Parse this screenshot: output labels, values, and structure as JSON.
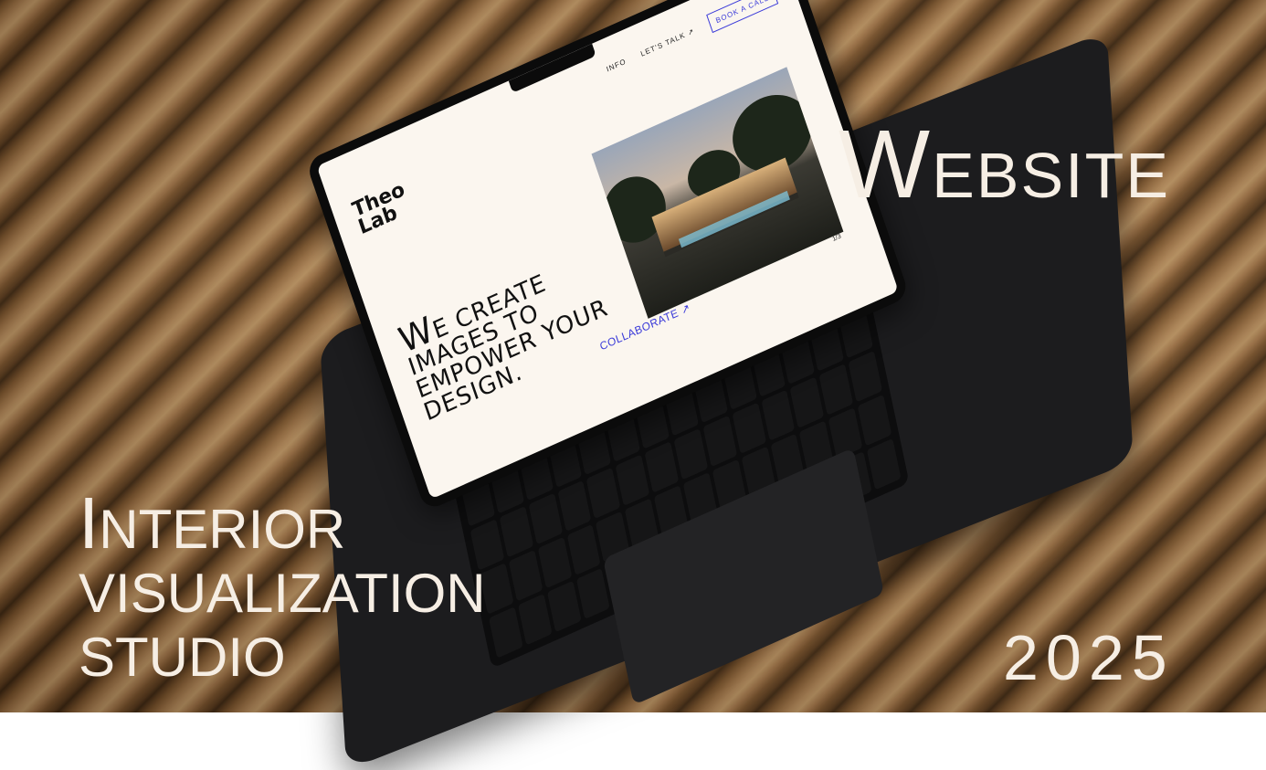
{
  "overlay": {
    "website_first": "W",
    "website_rest": "EBSITE",
    "studio_first": "I",
    "studio_line1_rest": "NTERIOR",
    "studio_line2": "VISUALIZATION",
    "studio_line3": "STUDIO",
    "year": "2025"
  },
  "site": {
    "logo_line1": "Theo",
    "logo_line2": "Lab",
    "nav": {
      "info": "INFO",
      "lets_talk": "LET'S TALK ↗",
      "book": "BOOK A CALL"
    },
    "hero": {
      "first": "W",
      "line1_rest": "E CREATE",
      "line2": "IMAGES  TO",
      "line3": "EMPOWER YOUR",
      "line4": "DESIGN."
    },
    "cta": "COLLABORATE ↗",
    "pager": "1/3"
  },
  "colors": {
    "accent": "#3b3bd9",
    "screen_bg": "#fbf6ef",
    "overlay_text": "#f6eee4"
  }
}
